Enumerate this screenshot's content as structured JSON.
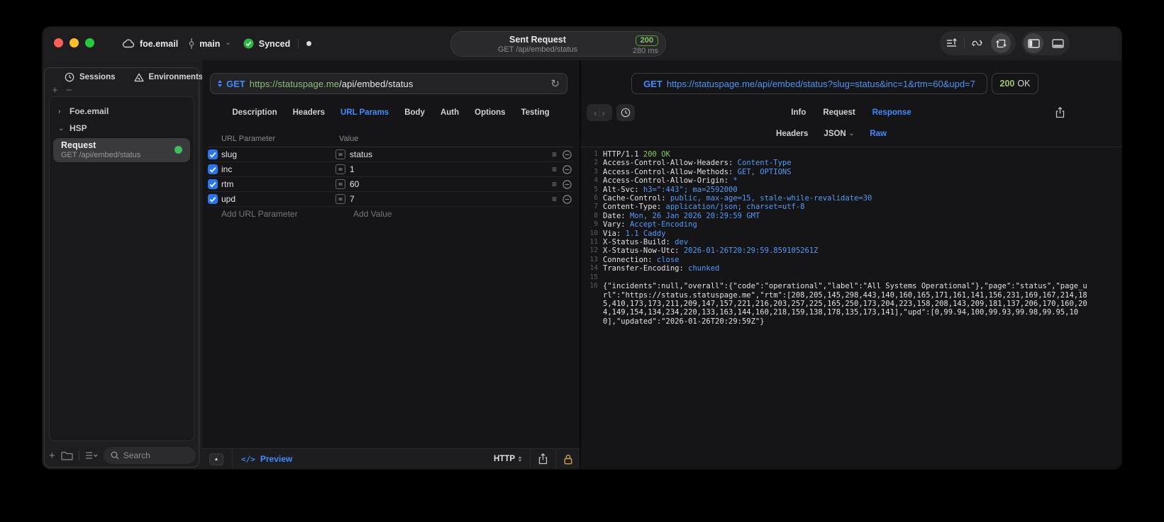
{
  "titlebar": {
    "project": "foe.email",
    "branch": "main",
    "sync_label": "Synced",
    "center_title": "Sent Request",
    "center_subtitle": "GET /api/embed/status",
    "status_code": "200",
    "duration": "280 ms"
  },
  "sidebar": {
    "tab_sessions": "Sessions",
    "tab_environments": "Environments",
    "group_collapsed": "Foe.email",
    "group_expanded": "HSP",
    "request_title": "Request",
    "request_subtitle": "GET /api/embed/status",
    "search_placeholder": "Search"
  },
  "request_panel": {
    "method": "GET",
    "url_host": "https://statuspage.me",
    "url_path": "/api/embed/status",
    "tabs": [
      "Description",
      "Headers",
      "URL Params",
      "Body",
      "Auth",
      "Options",
      "Testing"
    ],
    "active_tab": "URL Params",
    "table": {
      "col_param": "URL Parameter",
      "col_value": "Value",
      "rows": [
        {
          "name": "slug",
          "value": "status",
          "checked": true
        },
        {
          "name": "inc",
          "value": "1",
          "checked": true
        },
        {
          "name": "rtm",
          "value": "60",
          "checked": true
        },
        {
          "name": "upd",
          "value": "7",
          "checked": true
        }
      ],
      "add_param_placeholder": "Add URL Parameter",
      "add_value_placeholder": "Add Value"
    },
    "footer": {
      "preview": "Preview",
      "code_glyph": "</>",
      "protocol": "HTTP"
    }
  },
  "response_panel": {
    "method": "GET",
    "url": "https://statuspage.me/api/embed/status?slug=status&inc=1&rtm=60&upd=7",
    "status_number": "200",
    "status_text": "OK",
    "tabs": [
      "Info",
      "Request",
      "Response"
    ],
    "active_tab": "Response",
    "subtabs": [
      {
        "label": "Headers"
      },
      {
        "label": "JSON",
        "chevron": true
      },
      {
        "label": "Raw"
      }
    ],
    "active_subtab": "Raw",
    "body": {
      "status_line_prefix": "HTTP/1.1 ",
      "status_line_value": "200 OK",
      "headers": [
        {
          "name": "Access-Control-Allow-Headers",
          "value": "Content-Type"
        },
        {
          "name": "Access-Control-Allow-Methods",
          "value": "GET, OPTIONS"
        },
        {
          "name": "Access-Control-Allow-Origin",
          "value": "*"
        },
        {
          "name": "Alt-Svc",
          "value": "h3=\":443\"; ma=2592000"
        },
        {
          "name": "Cache-Control",
          "value": "public, max-age=15, stale-while-revalidate=30"
        },
        {
          "name": "Content-Type",
          "value": "application/json; charset=utf-8"
        },
        {
          "name": "Date",
          "value": "Mon, 26 Jan 2026 20:29:59 GMT"
        },
        {
          "name": "Vary",
          "value": "Accept-Encoding"
        },
        {
          "name": "Via",
          "value": "1.1 Caddy"
        },
        {
          "name": "X-Status-Build",
          "value": "dev"
        },
        {
          "name": "X-Status-Now-Utc",
          "value": "2026-01-26T20:29:59.859105261Z"
        },
        {
          "name": "Connection",
          "value": "close"
        },
        {
          "name": "Transfer-Encoding",
          "value": "chunked"
        }
      ],
      "json_body": "{\"incidents\":null,\"overall\":{\"code\":\"operational\",\"label\":\"All Systems Operational\"},\"page\":\"status\",\"page_url\":\"https://status.statuspage.me\",\"rtm\":[208,205,145,298,443,140,160,165,171,161,141,156,231,169,167,214,185,410,173,173,211,209,147,157,221,216,203,257,225,165,250,173,204,223,158,208,143,209,181,137,206,170,160,204,149,154,134,234,220,133,163,144,160,218,159,138,178,135,173,141],\"upd\":[0,99.94,100,99.93,99.98,99.95,100],\"updated\":\"2026-01-26T20:29:59Z\"}"
    }
  },
  "colors": {
    "accent_blue": "#3f8cff",
    "success_green": "#8ec25f",
    "url_green": "#8cbf7f",
    "header_value_blue": "#4f9cf9"
  }
}
